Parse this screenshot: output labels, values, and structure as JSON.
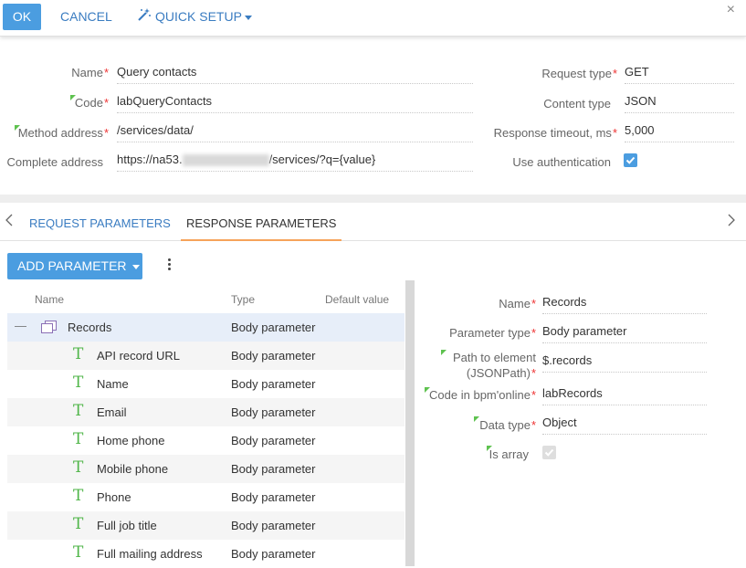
{
  "toolbar": {
    "ok_label": "OK",
    "cancel_label": "CANCEL",
    "quick_setup_label": "QUICK SETUP",
    "close_label": "×"
  },
  "fields": {
    "name": {
      "label": "Name",
      "value": "Query contacts",
      "required": true
    },
    "code": {
      "label": "Code",
      "value": "labQueryContacts",
      "required": true
    },
    "method_address": {
      "label": "Method address",
      "value": "/services/data/",
      "required": true
    },
    "complete_address": {
      "label": "Complete address",
      "value_prefix": "https://na53.",
      "value_suffix": "/services/?q={value}"
    },
    "request_type": {
      "label": "Request type",
      "value": "GET",
      "required": true
    },
    "content_type": {
      "label": "Content type",
      "value": "JSON"
    },
    "response_timeout": {
      "label": "Response timeout, ms",
      "value": "5,000",
      "required": true
    },
    "use_authentication": {
      "label": "Use authentication",
      "checked": true
    }
  },
  "tabs": {
    "request": "REQUEST PARAMETERS",
    "response": "RESPONSE PARAMETERS",
    "active": "response"
  },
  "add_parameter_label": "ADD PARAMETER",
  "grid": {
    "columns": {
      "name": "Name",
      "type": "Type",
      "default": "Default value"
    },
    "parent": {
      "name": "Records",
      "type": "Body parameter",
      "expand": "—"
    },
    "children": [
      {
        "name": "API record URL",
        "type": "Body parameter"
      },
      {
        "name": "Name",
        "type": "Body parameter"
      },
      {
        "name": "Email",
        "type": "Body parameter"
      },
      {
        "name": "Home phone",
        "type": "Body parameter"
      },
      {
        "name": "Mobile phone",
        "type": "Body parameter"
      },
      {
        "name": "Phone",
        "type": "Body parameter"
      },
      {
        "name": "Full job title",
        "type": "Body parameter"
      },
      {
        "name": "Full mailing address",
        "type": "Body parameter"
      }
    ],
    "child_icon": "T"
  },
  "details": {
    "name": {
      "label": "Name",
      "value": "Records"
    },
    "parameter_type": {
      "label": "Parameter type",
      "value": "Body parameter"
    },
    "path_line1": "Path to element",
    "path_line2": "(JSONPath)",
    "path_value": "$.records",
    "code": {
      "label": "Code in bpm'online",
      "value": "labRecords"
    },
    "data_type": {
      "label": "Data type",
      "value": "Object"
    },
    "is_array": {
      "label": "Is array",
      "checked": true
    }
  },
  "colors": {
    "accent": "#4b9de0",
    "tab_underline": "#f6a35a",
    "required": "#e33333",
    "marker": "#5ec24f"
  }
}
